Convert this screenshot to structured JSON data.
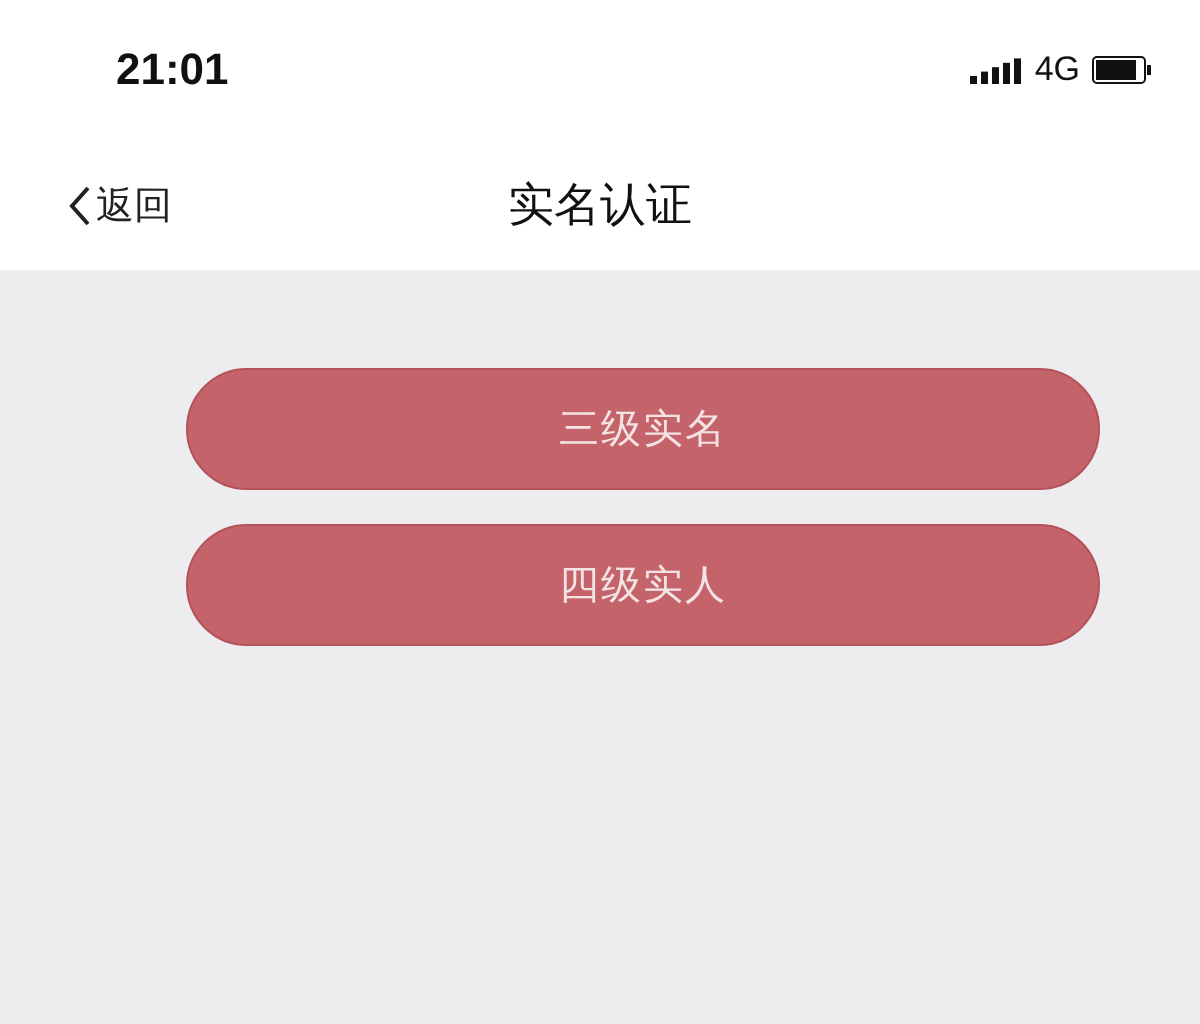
{
  "status_bar": {
    "time": "21:01",
    "network": "4G"
  },
  "nav_bar": {
    "back": "返回",
    "title": "实名认证"
  },
  "buttons": [
    {
      "label": "三级实名"
    },
    {
      "label": "四级实人"
    }
  ]
}
